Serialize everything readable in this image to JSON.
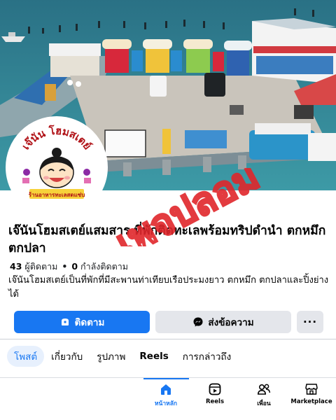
{
  "page": {
    "title": "เจ๊นันโฮมสเตย์แสมสาร ที่พักติดทะเลพร้อมทริปดำนำ ตกหมึก ตกปลา",
    "followers_count": "43",
    "followers_label": "ผู้ติดตาม",
    "following_count": "0",
    "following_label": "กำลังติดตาม",
    "description": "เจ๊นันโฮมสเตย์เป็นที่พักที่มีสะพานท่าเทียบเรือประมงยาว ตกหมึก ตกปลาและปิ้งย่างได้"
  },
  "avatar": {
    "logo_text_top": "เจ๊นัน โฮมสเตย์",
    "logo_text_bottom": "ร้านอาหารทะเลสดแซ่บ"
  },
  "stamp_text": "เพจปลอม",
  "actions": {
    "follow_label": "ติดตาม",
    "message_label": "ส่งข้อความ",
    "more_label": "···"
  },
  "tabs": [
    "โพสต์",
    "เกี่ยวกับ",
    "รูปภาพ",
    "Reels",
    "การกล่าวถึง"
  ],
  "bottom_nav": {
    "home": "หน้าหลัก",
    "reels": "Reels",
    "friends": "เพื่อน",
    "marketplace": "Marketplace"
  },
  "colors": {
    "accent": "#1877f2",
    "stamp": "#e0262b",
    "secondary_button": "#e4e6eb"
  },
  "icons": {
    "follow": "follow-icon",
    "message": "messenger-icon",
    "home": "home-icon",
    "reels": "reels-icon",
    "friends": "friends-icon",
    "marketplace": "marketplace-icon"
  }
}
